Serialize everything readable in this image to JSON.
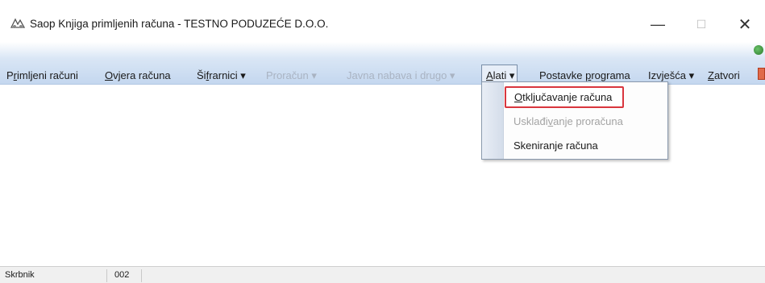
{
  "window": {
    "title": "Saop Knjiga primljenih računa - TESTNO PODUZEĆE D.O.O.",
    "minimize": "—",
    "maximize": "☐",
    "close": "✕"
  },
  "menu": {
    "primljeni_racuni": {
      "pre": "P",
      "ul": "r",
      "post": "imljeni računi"
    },
    "ovjera_racuna": {
      "pre": "",
      "ul": "O",
      "post": "vjera računa"
    },
    "sifrarnici": {
      "pre": "Ši",
      "ul": "f",
      "post": "rarnici ▾"
    },
    "proracun": "Proračun ▾",
    "javna_nabava": "Javna nabava i drugo ▾",
    "alati": {
      "pre": "",
      "ul": "A",
      "post": "lati ▾"
    },
    "postavke": {
      "pre": "Postavke ",
      "ul": "p",
      "post": "rograma"
    },
    "izvjesca": "Izvješća ▾",
    "zatvori": {
      "pre": "",
      "ul": "Z",
      "post": "atvori"
    }
  },
  "dropdown": {
    "otkljucavanje": {
      "pre": "",
      "ul": "O",
      "post": "tključavanje računa"
    },
    "uskladivanje": {
      "pre": "Usklađi",
      "ul": "v",
      "post": "anje proračuna"
    },
    "skeniranje": "Skeniranje računa"
  },
  "status": {
    "user": "Skrbnik",
    "code": "002"
  },
  "colors": {
    "highlight_border": "#d9363e",
    "menubar_gradient_end": "#c4d7ef"
  }
}
